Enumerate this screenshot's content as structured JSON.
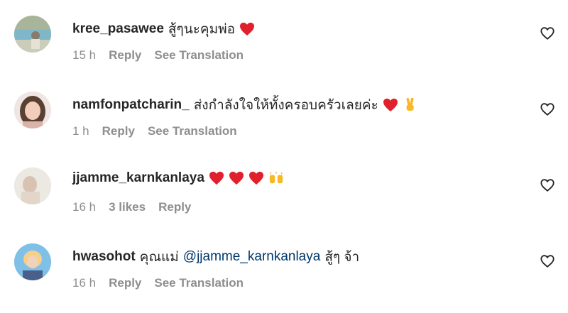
{
  "comments": [
    {
      "username": "kree_pasawee",
      "text": "สู้ๆนะคุมพ่อ",
      "emoji": [
        "red-heart"
      ],
      "time": "15 h",
      "reply": "Reply",
      "translation": "See Translation"
    },
    {
      "username": "namfonpatcharin_",
      "text": "ส่งกำลังใจให้ทั้งครอบครัวเลยค่ะ",
      "emoji": [
        "red-heart",
        "victory-hand"
      ],
      "time": "1 h",
      "reply": "Reply",
      "translation": "See Translation"
    },
    {
      "username": "jjamme_karnkanlaya",
      "text": "",
      "emoji": [
        "red-heart",
        "red-heart",
        "red-heart",
        "raising-hands"
      ],
      "time": "16 h",
      "likes": "3 likes",
      "reply": "Reply"
    },
    {
      "username": "hwasohot",
      "text_before": "คุณแม่",
      "mention": "@jjamme_karnkanlaya",
      "text_after": "สู้ๆ จ้า",
      "time": "16 h",
      "reply": "Reply",
      "translation": "See Translation"
    }
  ],
  "colors": {
    "username": "#262626",
    "meta": "#8e8e8e",
    "mention": "#00376b",
    "heart": "#e0202c"
  },
  "icons": [
    "heart-outline-icon",
    "red-heart-emoji",
    "victory-hand-emoji",
    "raising-hands-emoji"
  ]
}
